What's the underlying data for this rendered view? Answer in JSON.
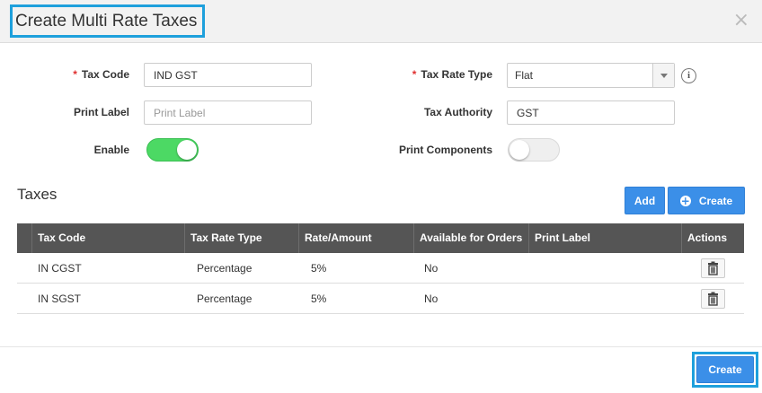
{
  "dialog": {
    "title": "Create Multi Rate Taxes",
    "close_glyph": "×"
  },
  "form": {
    "tax_code": {
      "label": "Tax Code",
      "required_mark": "*",
      "value": "IND GST"
    },
    "tax_rate_type": {
      "label": "Tax Rate Type",
      "required_mark": "*",
      "selected": "Flat"
    },
    "print_label": {
      "label": "Print Label",
      "value": "",
      "placeholder": "Print Label"
    },
    "tax_authority": {
      "label": "Tax Authority",
      "value": "GST"
    },
    "enable": {
      "label": "Enable",
      "on": true
    },
    "print_components": {
      "label": "Print Components",
      "on": false
    },
    "info_glyph": "i"
  },
  "taxes": {
    "title": "Taxes",
    "add_label": "Add",
    "create_label": "Create",
    "columns": [
      "Tax Code",
      "Tax Rate Type",
      "Rate/Amount",
      "Available for Orders",
      "Print Label",
      "Actions"
    ],
    "rows": [
      {
        "tax_code": "IN CGST",
        "tax_rate_type": "Percentage",
        "rate": "5%",
        "available": "No",
        "print_label": ""
      },
      {
        "tax_code": "IN SGST",
        "tax_rate_type": "Percentage",
        "rate": "5%",
        "available": "No",
        "print_label": ""
      }
    ]
  },
  "footer": {
    "create_label": "Create"
  },
  "colors": {
    "accent": "#3b8fe8",
    "highlight_border": "#1ea0dc",
    "toggle_on": "#4cd964",
    "table_header": "#555555",
    "required": "#e03030"
  }
}
